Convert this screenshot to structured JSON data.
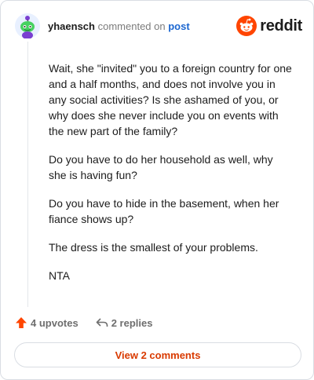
{
  "comment": {
    "username": "yhaensch",
    "verb": "commented on",
    "target": "post",
    "paragraphs": [
      "Wait, she \"invited\" you to a foreign country for one and a half months, and does not involve you in any social activities? Is she ashamed of you, or why does she never include you on events with the new part of the family?",
      "Do you have to do her household as well, why she is having fun?",
      "Do you have to hide in the basement, when her fiance shows up?",
      "The dress is the smallest of your problems.",
      "NTA"
    ],
    "upvotes": "4 upvotes",
    "replies": "2 replies"
  },
  "brand": {
    "name": "reddit",
    "icon": "reddit-logo-icon"
  },
  "view_button": {
    "label": "View 2 comments"
  },
  "colors": {
    "accent": "#d93a00",
    "upvote": "#ff4500",
    "link": "#1b66d0",
    "avatar": "#46d160"
  }
}
